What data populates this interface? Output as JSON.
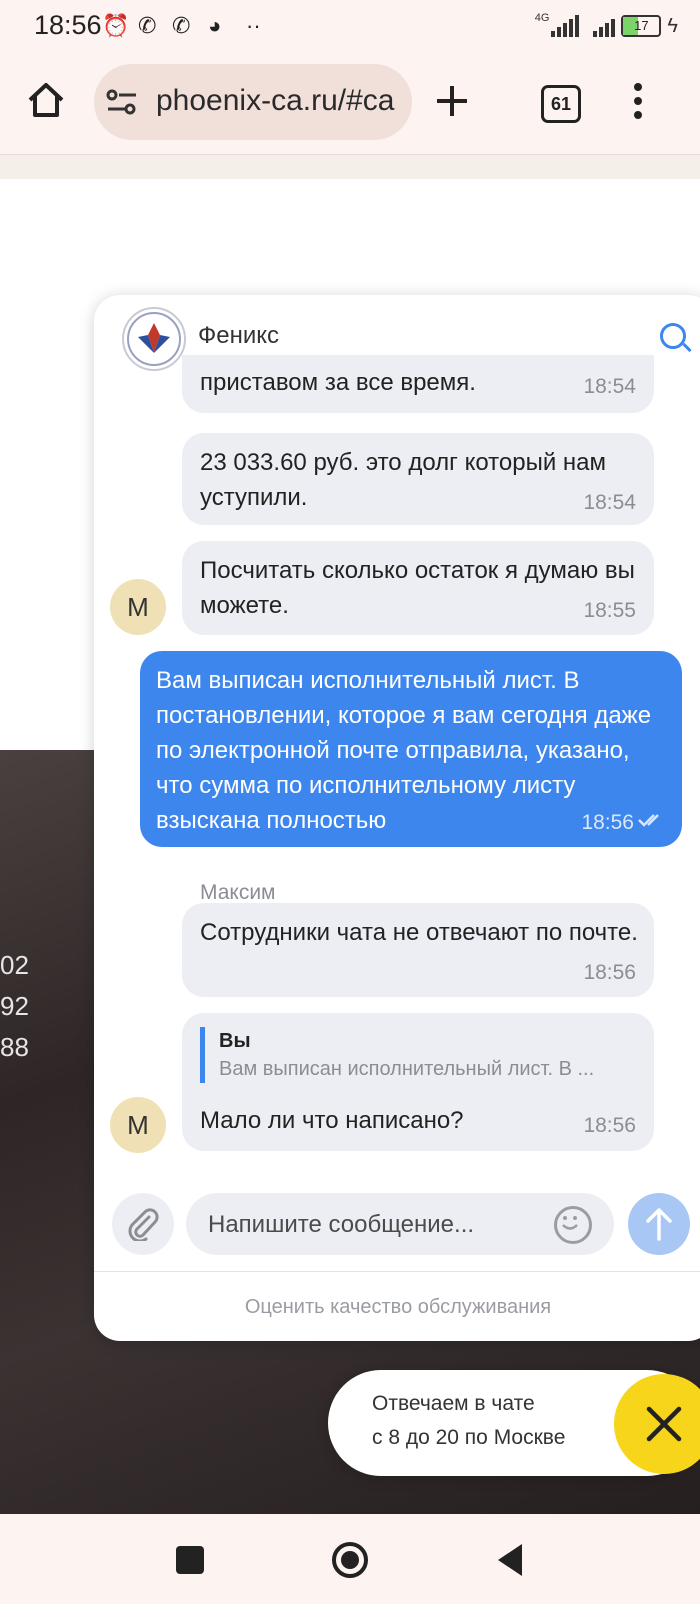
{
  "status_bar": {
    "time": "18:56",
    "network": "4G",
    "battery": "17",
    "icons": [
      "alarm-icon",
      "viber-icon",
      "whatsapp-icon",
      "app-icon",
      "more-notifications-icon",
      "signal-icon",
      "charging-icon"
    ]
  },
  "browser": {
    "url": "phoenix-ca.ru/#ca",
    "tab_count": "61"
  },
  "background_page": {
    "numbers": [
      "02",
      "92",
      "88"
    ]
  },
  "chat": {
    "title": "Феникс",
    "messages": [
      {
        "text": "приставом за все время.",
        "time": "18:54",
        "direction": "in"
      },
      {
        "text": "23 033.60 руб. это долг который нам уступили.",
        "time": "18:54",
        "direction": "in"
      },
      {
        "text": "Посчитать сколько остаток я думаю вы можете.",
        "time": "18:55",
        "direction": "in",
        "avatar": "М"
      },
      {
        "text": "Вам выписан исполнительный лист. В постановлении, которое я вам сегодня даже по электронной почте отправила, указано, что сумма по исполнительному листу взыскана полностью",
        "time": "18:56",
        "direction": "out"
      },
      {
        "sender": "Максим"
      },
      {
        "text": "Сотрудники чата не отвечают по почте.",
        "time": "18:56",
        "direction": "in"
      },
      {
        "quote_author": "Вы",
        "quote_text": "Вам выписан исполнительный лист. В ...",
        "text": "Мало ли что написано?",
        "time": "18:56",
        "direction": "in",
        "avatar": "М"
      }
    ],
    "input_placeholder": "Напишите сообщение...",
    "rate_link": "Оценить качество обслуживания"
  },
  "hours_pill": {
    "line1": "Отвечаем в чате",
    "line2": "с 8 до 20 по Москве"
  },
  "colors": {
    "accent_blue": "#3c86ee",
    "incoming_bubble": "#eceef3",
    "avatar_bg": "#efe1b5",
    "fab_yellow": "#f7d51a"
  }
}
